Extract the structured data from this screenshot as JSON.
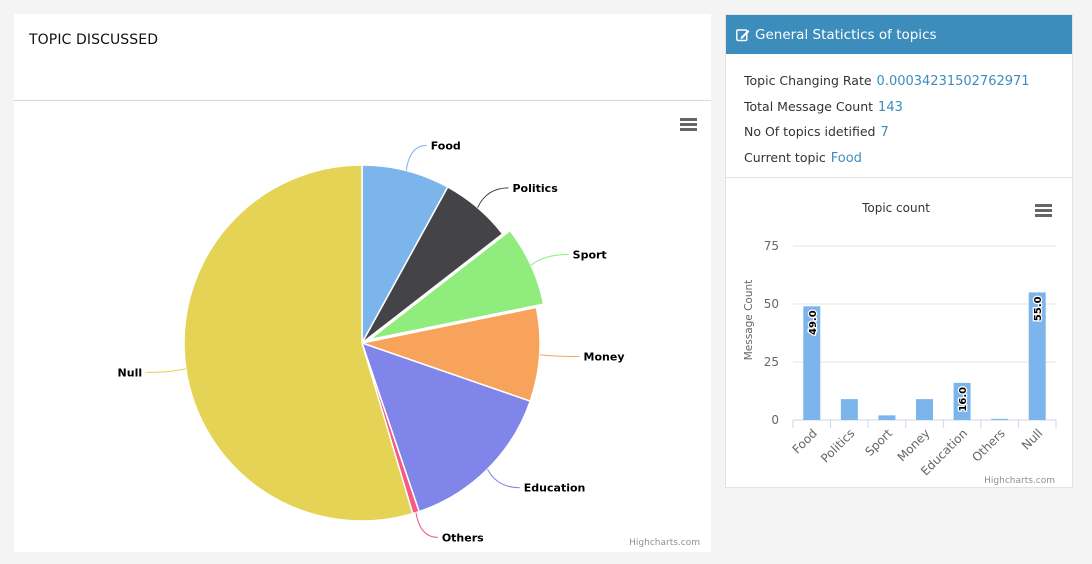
{
  "left_panel": {
    "title": "TOPIC DISCUSSED",
    "credits": "Highcharts.com"
  },
  "right_panel": {
    "header": "General Statictics of topics",
    "header_icon": "edit-icon",
    "stats": [
      {
        "label": "Topic Changing Rate",
        "value": "0.00034231502762971"
      },
      {
        "label": "Total Message Count",
        "value": "143"
      },
      {
        "label": "No Of topics idetified",
        "value": "7"
      },
      {
        "label": "Current topic",
        "value": "Food"
      }
    ],
    "credits": "Highcharts.com"
  },
  "colors": {
    "header_blue": "#3c8dbc",
    "bar": "#7cb5ec"
  },
  "chart_data": [
    {
      "type": "pie",
      "slices": [
        {
          "name": "Food",
          "value": 8.0,
          "color": "#7cb5ec"
        },
        {
          "name": "Politics",
          "value": 6.5,
          "color": "#434348"
        },
        {
          "name": "Sport",
          "value": 7.3,
          "color": "#90ed7d",
          "sliced": true
        },
        {
          "name": "Money",
          "value": 8.5,
          "color": "#f7a35c"
        },
        {
          "name": "Education",
          "value": 14.5,
          "color": "#8085e9"
        },
        {
          "name": "Others",
          "value": 0.6,
          "color": "#f15c80"
        },
        {
          "name": "Null",
          "value": 54.6,
          "color": "#e4d354"
        }
      ]
    },
    {
      "type": "bar",
      "title": "Topic count",
      "ylabel": "Message Count",
      "categories": [
        "Food",
        "Politics",
        "Sport",
        "Money",
        "Education",
        "Others",
        "Null"
      ],
      "values": [
        49,
        9,
        2,
        9,
        16,
        0.5,
        55
      ],
      "data_labels": [
        "49.0",
        "",
        "",
        "",
        "16.0",
        "",
        "55.0"
      ],
      "ylim": [
        0,
        75
      ],
      "yticks": [
        0,
        25,
        50,
        75
      ]
    }
  ]
}
